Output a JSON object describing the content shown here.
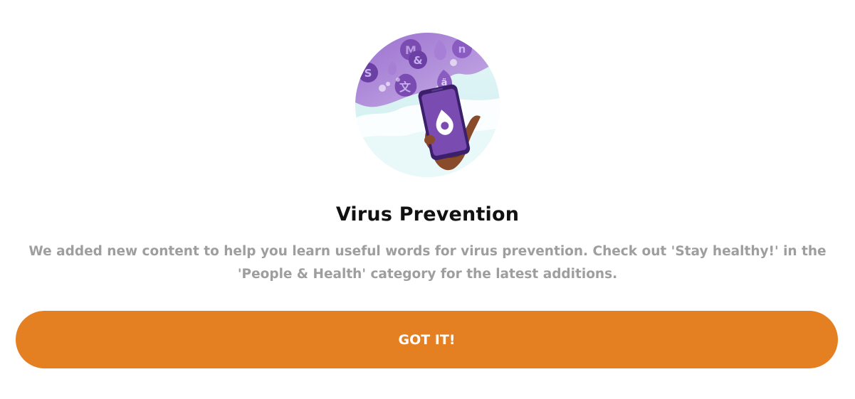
{
  "dialog": {
    "illustration_icon": "phone-with-language-bubbles-illustration",
    "title": "Virus Prevention",
    "message": "We added new content to help you learn useful words for virus prevention. Check out 'Stay healthy!' in the 'People & Health' category for the latest additions.",
    "confirm_label": "GOT IT!"
  },
  "colors": {
    "accent": "#e47f22",
    "title": "#111111",
    "message": "#9e9e9e",
    "illustration_purple": "#7a4bb0",
    "illustration_sky": "#d6f0f2"
  }
}
